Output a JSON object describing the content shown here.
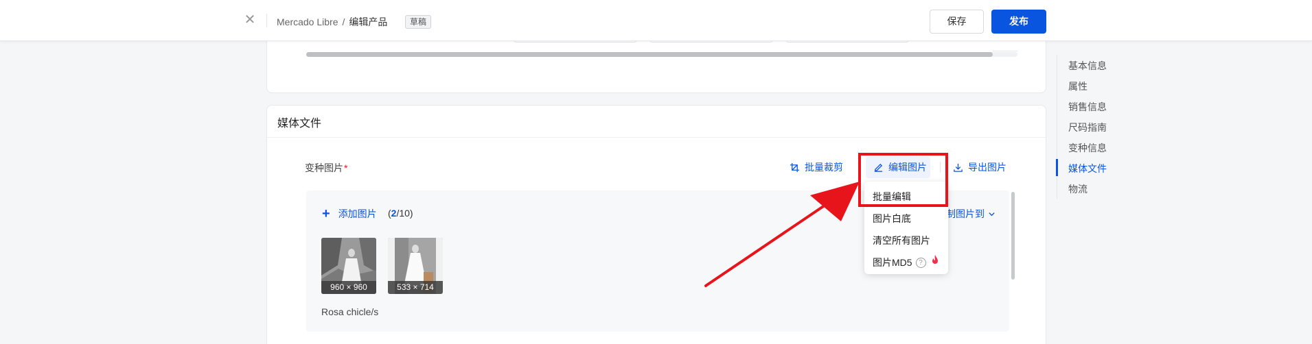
{
  "header": {
    "close_icon": "close-icon",
    "breadcrumb": {
      "store": "Mercado Libre",
      "separator": "/",
      "current": "编辑产品"
    },
    "badge": "草稿",
    "save_label": "保存",
    "publish_label": "发布",
    "accent": "#0a55e0"
  },
  "media": {
    "section_title": "媒体文件",
    "variant_label": "变种图片",
    "required_mark": "*",
    "tools": {
      "batch_crop": "批量裁剪",
      "edit_images": "编辑图片",
      "export_images": "导出图片"
    },
    "add_image": "添加图片",
    "count": {
      "open": "(",
      "current": "2",
      "rest": "/10)"
    },
    "copy_to": "制图片到",
    "thumbnails": [
      {
        "dimensions": "960 × 960"
      },
      {
        "dimensions": "533 × 714"
      }
    ],
    "variant_name": "Rosa chicle/s"
  },
  "dropdown": {
    "items": [
      "批量编辑",
      "图片白底",
      "清空所有图片",
      "图片MD5"
    ],
    "help_icon": "?",
    "highlight_color": "#e8141b"
  },
  "sidebar_nav": {
    "items": [
      "基本信息",
      "属性",
      "销售信息",
      "尺码指南",
      "变种信息",
      "媒体文件",
      "物流"
    ],
    "active": "媒体文件"
  }
}
